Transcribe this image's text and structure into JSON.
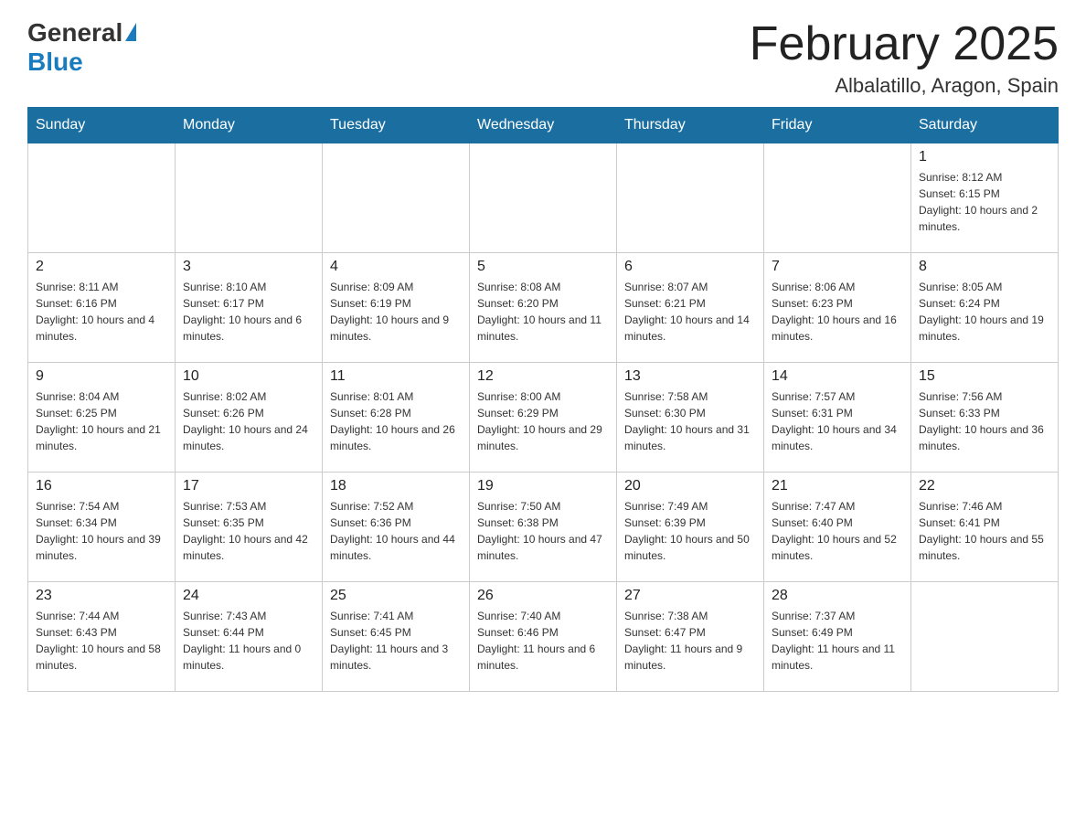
{
  "header": {
    "logo_general": "General",
    "logo_blue": "Blue",
    "title": "February 2025",
    "location": "Albalatillo, Aragon, Spain"
  },
  "weekdays": [
    "Sunday",
    "Monday",
    "Tuesday",
    "Wednesday",
    "Thursday",
    "Friday",
    "Saturday"
  ],
  "weeks": [
    [
      {
        "day": "",
        "sunrise": "",
        "sunset": "",
        "daylight": ""
      },
      {
        "day": "",
        "sunrise": "",
        "sunset": "",
        "daylight": ""
      },
      {
        "day": "",
        "sunrise": "",
        "sunset": "",
        "daylight": ""
      },
      {
        "day": "",
        "sunrise": "",
        "sunset": "",
        "daylight": ""
      },
      {
        "day": "",
        "sunrise": "",
        "sunset": "",
        "daylight": ""
      },
      {
        "day": "",
        "sunrise": "",
        "sunset": "",
        "daylight": ""
      },
      {
        "day": "1",
        "sunrise": "Sunrise: 8:12 AM",
        "sunset": "Sunset: 6:15 PM",
        "daylight": "Daylight: 10 hours and 2 minutes."
      }
    ],
    [
      {
        "day": "2",
        "sunrise": "Sunrise: 8:11 AM",
        "sunset": "Sunset: 6:16 PM",
        "daylight": "Daylight: 10 hours and 4 minutes."
      },
      {
        "day": "3",
        "sunrise": "Sunrise: 8:10 AM",
        "sunset": "Sunset: 6:17 PM",
        "daylight": "Daylight: 10 hours and 6 minutes."
      },
      {
        "day": "4",
        "sunrise": "Sunrise: 8:09 AM",
        "sunset": "Sunset: 6:19 PM",
        "daylight": "Daylight: 10 hours and 9 minutes."
      },
      {
        "day": "5",
        "sunrise": "Sunrise: 8:08 AM",
        "sunset": "Sunset: 6:20 PM",
        "daylight": "Daylight: 10 hours and 11 minutes."
      },
      {
        "day": "6",
        "sunrise": "Sunrise: 8:07 AM",
        "sunset": "Sunset: 6:21 PM",
        "daylight": "Daylight: 10 hours and 14 minutes."
      },
      {
        "day": "7",
        "sunrise": "Sunrise: 8:06 AM",
        "sunset": "Sunset: 6:23 PM",
        "daylight": "Daylight: 10 hours and 16 minutes."
      },
      {
        "day": "8",
        "sunrise": "Sunrise: 8:05 AM",
        "sunset": "Sunset: 6:24 PM",
        "daylight": "Daylight: 10 hours and 19 minutes."
      }
    ],
    [
      {
        "day": "9",
        "sunrise": "Sunrise: 8:04 AM",
        "sunset": "Sunset: 6:25 PM",
        "daylight": "Daylight: 10 hours and 21 minutes."
      },
      {
        "day": "10",
        "sunrise": "Sunrise: 8:02 AM",
        "sunset": "Sunset: 6:26 PM",
        "daylight": "Daylight: 10 hours and 24 minutes."
      },
      {
        "day": "11",
        "sunrise": "Sunrise: 8:01 AM",
        "sunset": "Sunset: 6:28 PM",
        "daylight": "Daylight: 10 hours and 26 minutes."
      },
      {
        "day": "12",
        "sunrise": "Sunrise: 8:00 AM",
        "sunset": "Sunset: 6:29 PM",
        "daylight": "Daylight: 10 hours and 29 minutes."
      },
      {
        "day": "13",
        "sunrise": "Sunrise: 7:58 AM",
        "sunset": "Sunset: 6:30 PM",
        "daylight": "Daylight: 10 hours and 31 minutes."
      },
      {
        "day": "14",
        "sunrise": "Sunrise: 7:57 AM",
        "sunset": "Sunset: 6:31 PM",
        "daylight": "Daylight: 10 hours and 34 minutes."
      },
      {
        "day": "15",
        "sunrise": "Sunrise: 7:56 AM",
        "sunset": "Sunset: 6:33 PM",
        "daylight": "Daylight: 10 hours and 36 minutes."
      }
    ],
    [
      {
        "day": "16",
        "sunrise": "Sunrise: 7:54 AM",
        "sunset": "Sunset: 6:34 PM",
        "daylight": "Daylight: 10 hours and 39 minutes."
      },
      {
        "day": "17",
        "sunrise": "Sunrise: 7:53 AM",
        "sunset": "Sunset: 6:35 PM",
        "daylight": "Daylight: 10 hours and 42 minutes."
      },
      {
        "day": "18",
        "sunrise": "Sunrise: 7:52 AM",
        "sunset": "Sunset: 6:36 PM",
        "daylight": "Daylight: 10 hours and 44 minutes."
      },
      {
        "day": "19",
        "sunrise": "Sunrise: 7:50 AM",
        "sunset": "Sunset: 6:38 PM",
        "daylight": "Daylight: 10 hours and 47 minutes."
      },
      {
        "day": "20",
        "sunrise": "Sunrise: 7:49 AM",
        "sunset": "Sunset: 6:39 PM",
        "daylight": "Daylight: 10 hours and 50 minutes."
      },
      {
        "day": "21",
        "sunrise": "Sunrise: 7:47 AM",
        "sunset": "Sunset: 6:40 PM",
        "daylight": "Daylight: 10 hours and 52 minutes."
      },
      {
        "day": "22",
        "sunrise": "Sunrise: 7:46 AM",
        "sunset": "Sunset: 6:41 PM",
        "daylight": "Daylight: 10 hours and 55 minutes."
      }
    ],
    [
      {
        "day": "23",
        "sunrise": "Sunrise: 7:44 AM",
        "sunset": "Sunset: 6:43 PM",
        "daylight": "Daylight: 10 hours and 58 minutes."
      },
      {
        "day": "24",
        "sunrise": "Sunrise: 7:43 AM",
        "sunset": "Sunset: 6:44 PM",
        "daylight": "Daylight: 11 hours and 0 minutes."
      },
      {
        "day": "25",
        "sunrise": "Sunrise: 7:41 AM",
        "sunset": "Sunset: 6:45 PM",
        "daylight": "Daylight: 11 hours and 3 minutes."
      },
      {
        "day": "26",
        "sunrise": "Sunrise: 7:40 AM",
        "sunset": "Sunset: 6:46 PM",
        "daylight": "Daylight: 11 hours and 6 minutes."
      },
      {
        "day": "27",
        "sunrise": "Sunrise: 7:38 AM",
        "sunset": "Sunset: 6:47 PM",
        "daylight": "Daylight: 11 hours and 9 minutes."
      },
      {
        "day": "28",
        "sunrise": "Sunrise: 7:37 AM",
        "sunset": "Sunset: 6:49 PM",
        "daylight": "Daylight: 11 hours and 11 minutes."
      },
      {
        "day": "",
        "sunrise": "",
        "sunset": "",
        "daylight": ""
      }
    ]
  ]
}
